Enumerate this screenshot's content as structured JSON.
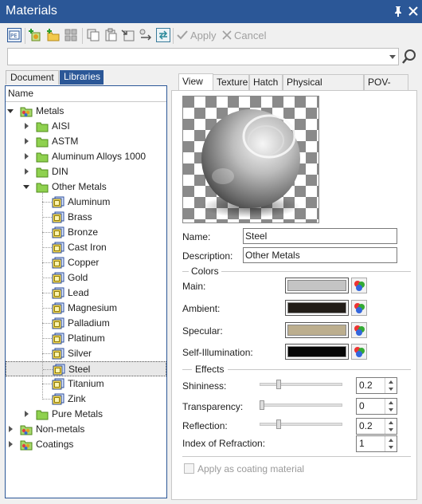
{
  "window": {
    "title": "Materials"
  },
  "toolbar": {
    "apply_label": "Apply",
    "cancel_label": "Cancel"
  },
  "search": {
    "value": "",
    "placeholder": ""
  },
  "left_tabs": [
    "Document",
    "Libraries"
  ],
  "tree": {
    "header": "Name",
    "metals": "Metals",
    "groups": [
      "AISI",
      "ASTM",
      "Aluminum Alloys 1000",
      "DIN",
      "Other Metals"
    ],
    "other_metals": [
      "Aluminum",
      "Brass",
      "Bronze",
      "Cast Iron",
      "Copper",
      "Gold",
      "Lead",
      "Magnesium",
      "Palladium",
      "Platinum",
      "Silver",
      "Steel",
      "Titanium",
      "Zink"
    ],
    "pure_metals": "Pure Metals",
    "non_metals": "Non-metals",
    "coatings": "Coatings",
    "selected": "Steel"
  },
  "right_tabs": [
    "View",
    "Texture",
    "Hatch",
    "Physical Properties",
    "POV-Ray"
  ],
  "form": {
    "name_label": "Name:",
    "name_value": "Steel",
    "desc_label": "Description:",
    "desc_value": "Other Metals",
    "colors_group": "Colors",
    "main_label": "Main:",
    "ambient_label": "Ambient:",
    "specular_label": "Specular:",
    "selfillum_label": "Self-Illumination:",
    "effects_group": "Effects",
    "shininess_label": "Shininess:",
    "shininess_value": "0.2",
    "transparency_label": "Transparency:",
    "transparency_value": "0",
    "reflection_label": "Reflection:",
    "reflection_value": "0.2",
    "ior_label": "Index of Refraction:",
    "ior_value": "1",
    "coating_label": "Apply as coating material"
  },
  "colors": {
    "accent": "#2b5797",
    "main": "#c4c4c4",
    "ambient": "#221d18",
    "specular": "#bcae8e",
    "self_illumination": "#060606"
  },
  "levels": {
    "shininess": 0.2,
    "transparency": 0,
    "reflection": 0.2
  }
}
